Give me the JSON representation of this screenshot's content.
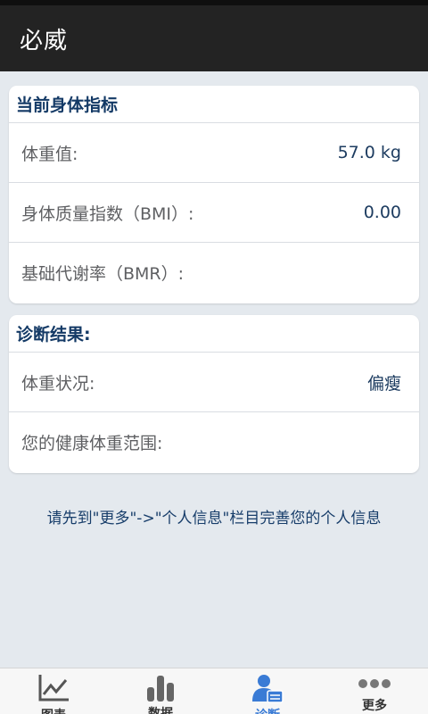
{
  "app_bar": {
    "title": "必威"
  },
  "body_metrics": {
    "title": "当前身体指标",
    "rows": [
      {
        "label": "体重值:",
        "value": "57.0 kg"
      },
      {
        "label": "身体质量指数（BMI）:",
        "value": "0.00"
      },
      {
        "label": "基础代谢率（BMR）:",
        "value": ""
      }
    ]
  },
  "diagnosis": {
    "title": "诊断结果:",
    "rows": [
      {
        "label": "体重状况:",
        "value": "偏瘦"
      },
      {
        "label": "您的健康体重范围:",
        "value": ""
      }
    ]
  },
  "hint": "请先到\"更多\"->\"个人信息\"栏目完善您的个人信息",
  "tabs": [
    {
      "label": "图表",
      "icon": "line-chart-icon"
    },
    {
      "label": "数据",
      "icon": "bar-chart-icon"
    },
    {
      "label": "诊断",
      "icon": "user-card-icon",
      "active": true
    },
    {
      "label": "更多",
      "icon": "more-dots-icon"
    }
  ],
  "colors": {
    "accent": "#3a7bd5",
    "header_bg": "#232323",
    "heading_text": "#143a66"
  }
}
